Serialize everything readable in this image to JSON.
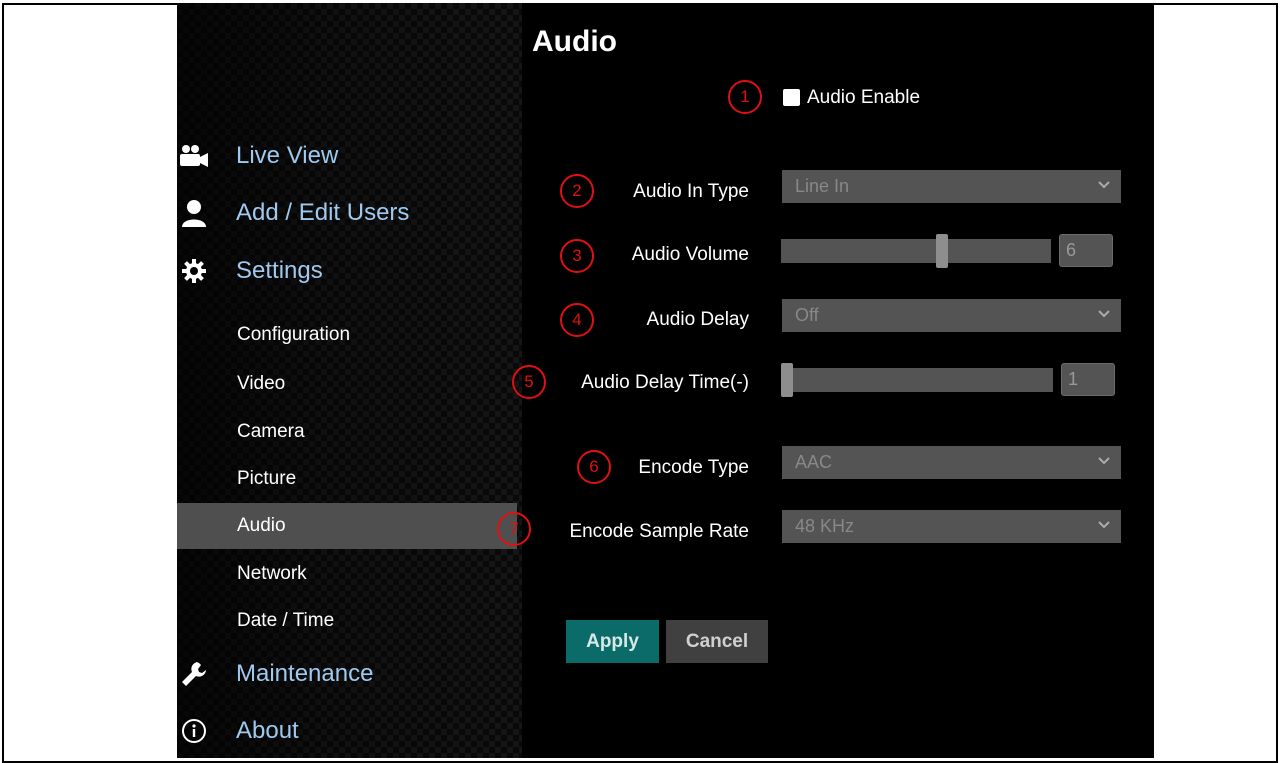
{
  "page": {
    "title": "Audio"
  },
  "sidebar": {
    "main_items": [
      {
        "label": "Live View",
        "icon": "video-camera-icon"
      },
      {
        "label": "Add / Edit Users",
        "icon": "user-icon"
      },
      {
        "label": "Settings",
        "icon": "gear-icon"
      },
      {
        "label": "Maintenance",
        "icon": "wrench-icon"
      },
      {
        "label": "About",
        "icon": "info-icon"
      }
    ],
    "sub_items": [
      {
        "label": "Configuration"
      },
      {
        "label": "Video"
      },
      {
        "label": "Camera"
      },
      {
        "label": "Picture"
      },
      {
        "label": "Audio",
        "active": true
      },
      {
        "label": "Network"
      },
      {
        "label": "Date / Time"
      }
    ]
  },
  "form": {
    "audio_enable": {
      "label": "Audio Enable",
      "checked": false,
      "callout": "1"
    },
    "audio_in_type": {
      "label": "Audio In Type",
      "value": "Line In",
      "callout": "2"
    },
    "audio_volume": {
      "label": "Audio Volume",
      "value": "6",
      "callout": "3",
      "level": 0.6
    },
    "audio_delay": {
      "label": "Audio Delay",
      "value": "Off",
      "callout": "4"
    },
    "audio_delay_time": {
      "label": "Audio Delay Time(-)",
      "value": "1",
      "callout": "5",
      "level": 0.0
    },
    "encode_type": {
      "label": "Encode Type",
      "value": "AAC",
      "callout": "6"
    },
    "encode_sample_rate": {
      "label": "Encode Sample Rate",
      "value": "48 KHz",
      "callout": "7"
    }
  },
  "buttons": {
    "apply": "Apply",
    "cancel": "Cancel"
  },
  "colors": {
    "accent_link": "#9fc9ee",
    "apply_bg": "#0b6b69",
    "callout": "#e01010",
    "control_bg": "#545454"
  }
}
